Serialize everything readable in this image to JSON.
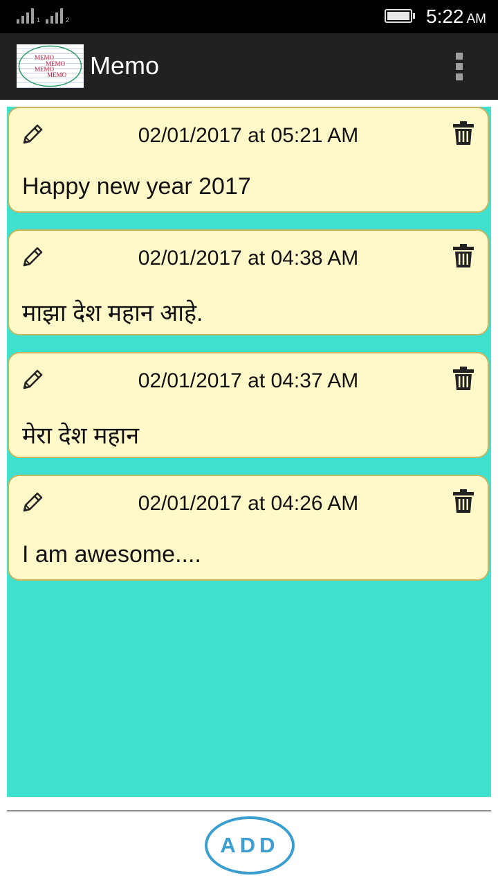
{
  "status_bar": {
    "sim1_label": "1",
    "sim2_label": "2",
    "time": "5:22",
    "ampm": "AM"
  },
  "app_bar": {
    "logo_words": [
      "MEMO",
      "MEMO",
      "MEMO",
      "MEMO"
    ],
    "title": "Memo",
    "overflow_icon": "more-vert-icon"
  },
  "memos": [
    {
      "date": "02/01/2017 at 05:21 AM",
      "text": "Happy new year 2017"
    },
    {
      "date": "02/01/2017 at 04:38 AM",
      "text": "माझा देश महान आहे."
    },
    {
      "date": "02/01/2017 at 04:37 AM",
      "text": "मेरा देश महान"
    },
    {
      "date": "02/01/2017 at 04:26 AM",
      "text": "I am awesome...."
    }
  ],
  "icons": {
    "edit": "pencil-icon",
    "delete": "trash-icon"
  },
  "add_button": {
    "label": "ADD"
  },
  "colors": {
    "status_bar_bg": "#000000",
    "app_bar_bg": "#212121",
    "list_bg": "#40e0cf",
    "card_bg": "#fff8c9",
    "card_border": "#c8b560",
    "add_accent": "#3a9fd0"
  }
}
